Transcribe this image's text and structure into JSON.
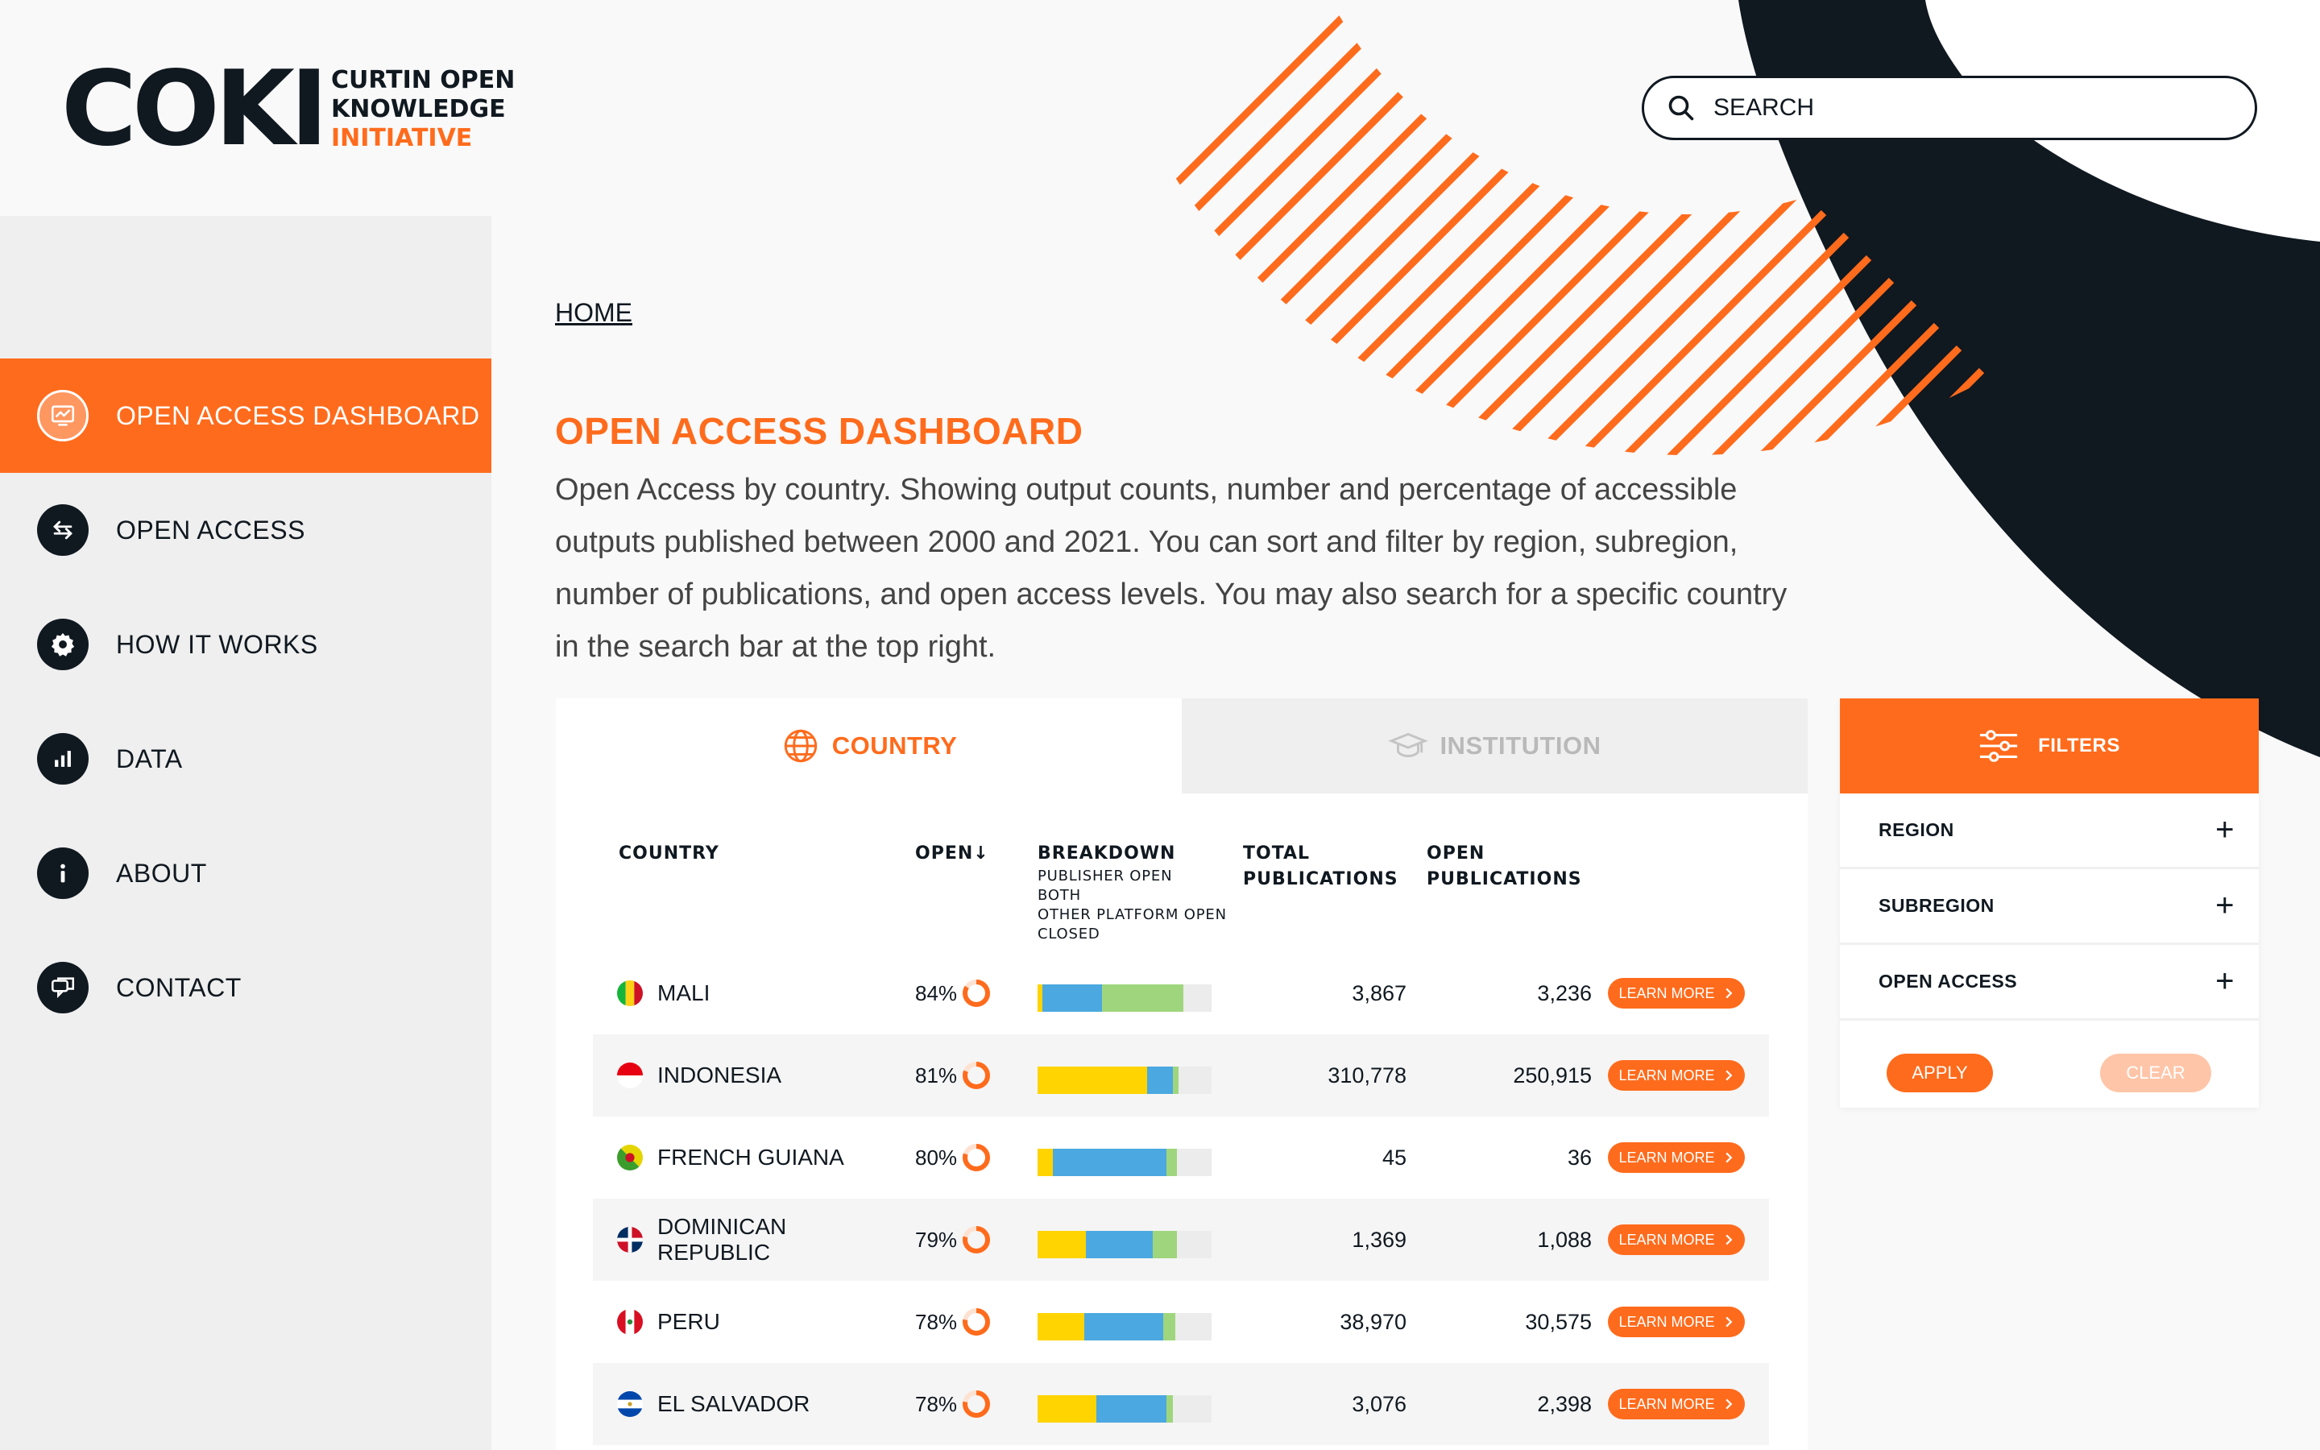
{
  "colors": {
    "accent": "#ff6b1c",
    "dark": "#101820",
    "publisher_open": "#ffd400",
    "both": "#4ba8e0",
    "other_platform_open": "#9fd67d",
    "closed": "#ececec"
  },
  "logo": {
    "mark": "COKI",
    "line1": "CURTIN OPEN",
    "line2": "KNOWLEDGE",
    "line3": "INITIATIVE"
  },
  "search": {
    "placeholder": "SEARCH",
    "icon": "search-icon"
  },
  "sidebar": {
    "items": [
      {
        "label": "OPEN ACCESS DASHBOARD",
        "icon": "dashboard-icon",
        "active": true
      },
      {
        "label": "OPEN ACCESS",
        "icon": "swap-arrows-icon",
        "active": false
      },
      {
        "label": "HOW IT WORKS",
        "icon": "gear-icon",
        "active": false
      },
      {
        "label": "DATA",
        "icon": "bar-chart-icon",
        "active": false
      },
      {
        "label": "ABOUT",
        "icon": "info-icon",
        "active": false
      },
      {
        "label": "CONTACT",
        "icon": "chat-icon",
        "active": false
      }
    ]
  },
  "breadcrumb": {
    "home": "HOME"
  },
  "page": {
    "title": "OPEN ACCESS DASHBOARD",
    "description": "Open Access by country. Showing output counts, number and percentage of accessible outputs published between 2000 and 2021. You can sort and filter by region, subregion, number of publications, and open access levels. You may also search for a specific country in the search bar at the top right."
  },
  "tabs": [
    {
      "label": "COUNTRY",
      "icon": "globe-icon",
      "active": true
    },
    {
      "label": "INSTITUTION",
      "icon": "graduation-cap-icon",
      "active": false
    }
  ],
  "table": {
    "headers": {
      "country": "COUNTRY",
      "open": "OPEN",
      "open_sort": "↓",
      "breakdown": "BREAKDOWN",
      "breakdown_legend": [
        "PUBLISHER OPEN",
        "BOTH",
        "OTHER PLATFORM OPEN",
        "CLOSED"
      ],
      "total_line1": "TOTAL",
      "total_line2": "PUBLICATIONS",
      "openpub_line1": "OPEN",
      "openpub_line2": "PUBLICATIONS"
    },
    "learn_more_label": "LEARN MORE",
    "rows": [
      {
        "country": "MALI",
        "open": "84%",
        "open_value": 84,
        "breakdown": [
          3,
          34,
          47,
          16
        ],
        "total": "3,867",
        "open_pubs": "3,236",
        "flag": "mali"
      },
      {
        "country": "INDONESIA",
        "open": "81%",
        "open_value": 81,
        "breakdown": [
          63,
          15,
          3,
          19
        ],
        "total": "310,778",
        "open_pubs": "250,915",
        "flag": "indonesia"
      },
      {
        "country": "FRENCH GUIANA",
        "open": "80%",
        "open_value": 80,
        "breakdown": [
          9,
          65,
          6,
          20
        ],
        "total": "45",
        "open_pubs": "36",
        "flag": "french-guiana"
      },
      {
        "country": "DOMINICAN REPUBLIC",
        "open": "79%",
        "open_value": 79,
        "breakdown": [
          28,
          38,
          14,
          20
        ],
        "total": "1,369",
        "open_pubs": "1,088",
        "flag": "dominican-republic"
      },
      {
        "country": "PERU",
        "open": "78%",
        "open_value": 78,
        "breakdown": [
          27,
          45,
          7,
          21
        ],
        "total": "38,970",
        "open_pubs": "30,575",
        "flag": "peru"
      },
      {
        "country": "EL SALVADOR",
        "open": "78%",
        "open_value": 78,
        "breakdown": [
          34,
          40,
          4,
          22
        ],
        "total": "3,076",
        "open_pubs": "2,398",
        "flag": "el-salvador"
      }
    ]
  },
  "filters": {
    "title": "FILTERS",
    "icon": "sliders-icon",
    "items": [
      "REGION",
      "SUBREGION",
      "OPEN ACCESS"
    ],
    "expand_icon": "+",
    "apply": "APPLY",
    "clear": "CLEAR"
  }
}
